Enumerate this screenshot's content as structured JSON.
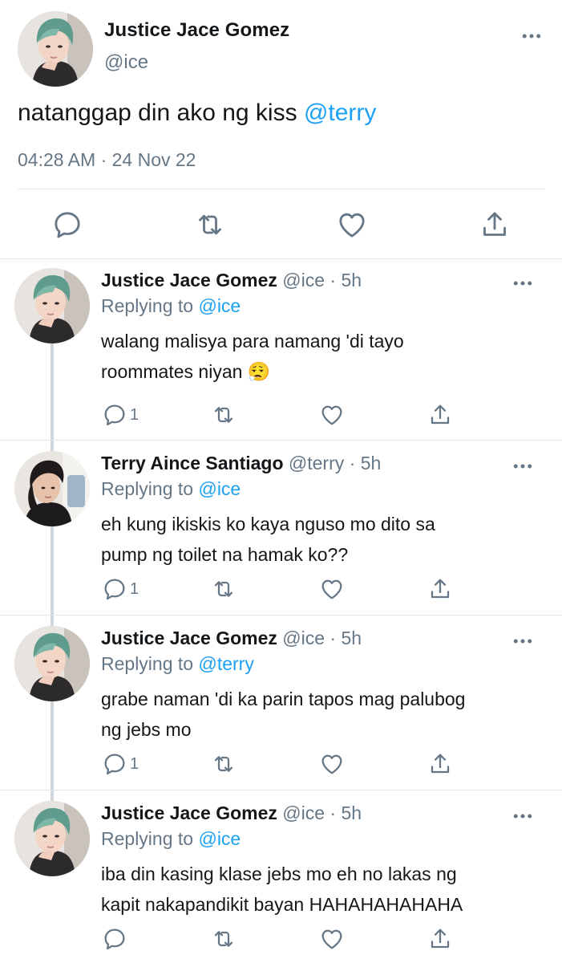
{
  "main_tweet": {
    "author_name": "Justice Jace Gomez",
    "author_handle": "@ice",
    "text": "natanggap din ako ng kiss ",
    "mention": "@terry",
    "timestamp": "04:28 AM · 24 Nov 22"
  },
  "replies": [
    {
      "name": "Justice Jace Gomez",
      "handle": "@ice",
      "time": " · 5h",
      "replying_label": "Replying to ",
      "replying_to": "@ice",
      "line1": "walang malisya para namang 'di tayo",
      "line2": "roommates niyan 😮‍💨",
      "reply_count": "1"
    },
    {
      "name": "Terry Aince Santiago",
      "handle": "@terry",
      "time": " · 5h",
      "replying_label": "Replying to ",
      "replying_to": "@ice",
      "line1": "eh kung ikiskis ko kaya nguso mo dito sa",
      "line2": "pump ng toilet na hamak ko??",
      "reply_count": "1"
    },
    {
      "name": "Justice Jace Gomez",
      "handle": "@ice",
      "time": " · 5h",
      "replying_label": "Replying to ",
      "replying_to": "@terry",
      "line1": "grabe naman 'di ka parin tapos mag palubog",
      "line2": "ng jebs mo",
      "reply_count": "1"
    },
    {
      "name": "Justice Jace Gomez",
      "handle": "@ice",
      "time": " · 5h",
      "replying_label": "Replying to ",
      "replying_to": "@ice",
      "line1": "iba din kasing klase jebs mo eh no lakas ng",
      "line2": "kapit nakapandikit bayan HAHAHAHAHAHA",
      "reply_count": ""
    }
  ],
  "icons": [
    "reply-icon",
    "retweet-icon",
    "like-icon",
    "share-icon",
    "more-icon"
  ],
  "colors": {
    "link": "#1da1f2",
    "secondary": "#657786",
    "text": "#14171a",
    "divider": "#e1e8ed"
  }
}
